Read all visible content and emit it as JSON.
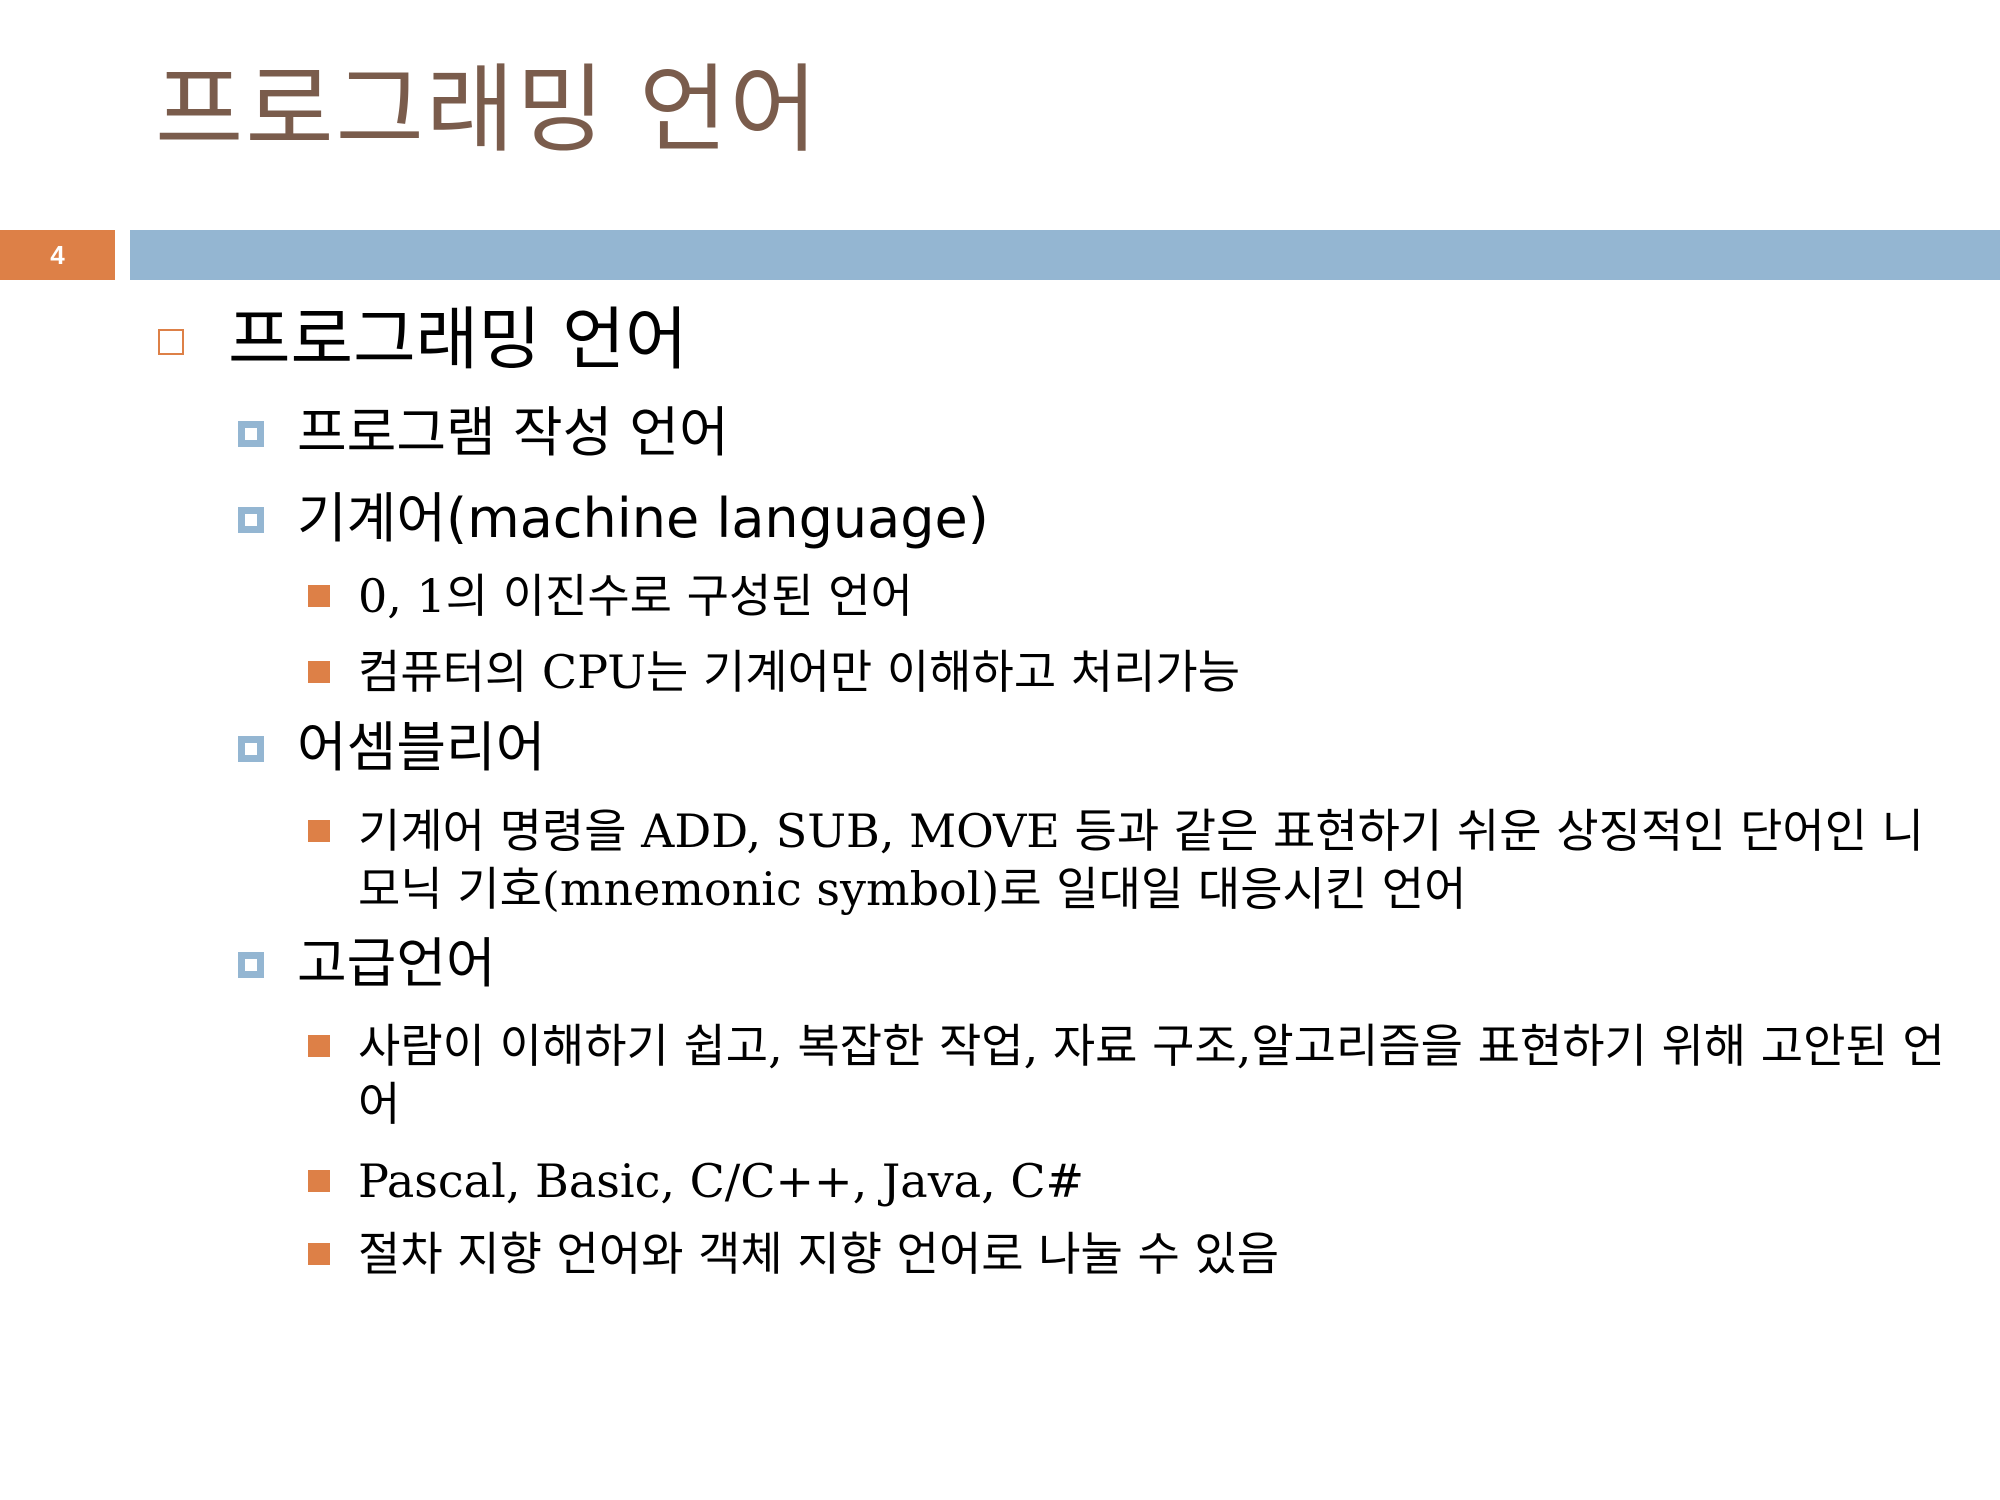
{
  "slide": {
    "title": "프로그래밍 언어",
    "number": "4"
  },
  "colors": {
    "title": "#7a5c4c",
    "accent_orange": "#dd8047",
    "accent_blue": "#94b6d2"
  },
  "content": {
    "l1": "프로그래밍 언어",
    "items": [
      {
        "text": "프로그램 작성 언어"
      },
      {
        "text": "기계어(machine language)",
        "subitems": [
          "0, 1의 이진수로 구성된 언어",
          "컴퓨터의 CPU는 기계어만 이해하고 처리가능"
        ]
      },
      {
        "text": "어셈블리어",
        "subitems": [
          "기계어 명령을 ADD, SUB, MOVE 등과 같은 표현하기 쉬운 상징적인 단어인 니모닉 기호(mnemonic symbol)로 일대일 대응시킨 언어"
        ]
      },
      {
        "text": "고급언어",
        "subitems": [
          "사람이 이해하기 쉽고, 복잡한 작업, 자료 구조,알고리즘을 표현하기 위해 고안된 언어",
          "Pascal, Basic, C/C++, Java, C#",
          "절차 지향 언어와 객체 지향 언어로 나눌 수 있음"
        ]
      }
    ]
  }
}
